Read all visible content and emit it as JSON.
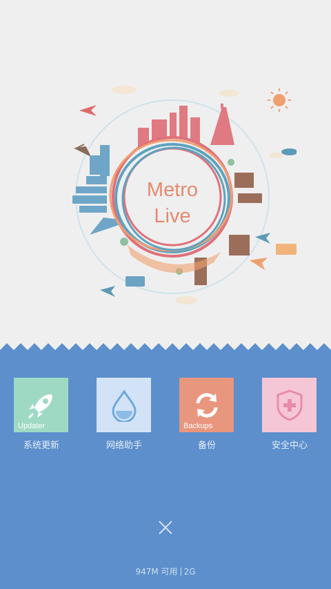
{
  "splash": {
    "logo_line1": "Metro",
    "logo_line2": "Live"
  },
  "tiles": [
    {
      "name": "Updater",
      "label": "系统更新",
      "color": "#9ed9c4",
      "icon": "rocket-icon"
    },
    {
      "name": "",
      "label": "网络助手",
      "color": "#d3e3f7",
      "icon": "water-drop-icon"
    },
    {
      "name": "Backups",
      "label": "备份",
      "color": "#e9967e",
      "icon": "sync-icon"
    },
    {
      "name": "",
      "label": "安全中心",
      "color": "#f4c6d6",
      "icon": "shield-plus-icon"
    }
  ],
  "status": {
    "memory": "947M 可用",
    "network": "2G"
  },
  "colors": {
    "background_top": "#efefef",
    "background_bottom": "#5c8fcc",
    "logo_text": "#e48a70"
  }
}
